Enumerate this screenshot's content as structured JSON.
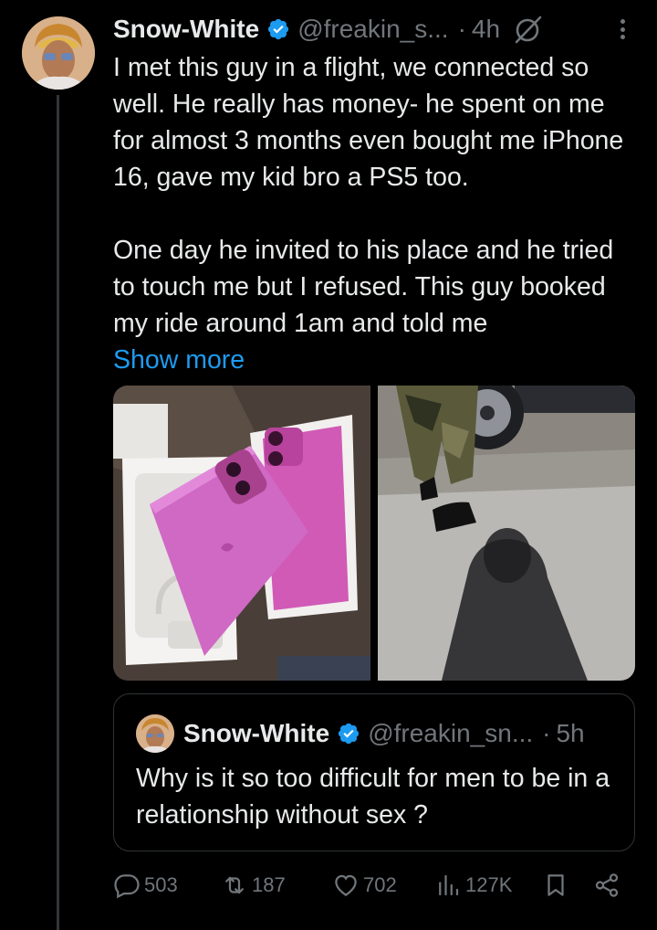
{
  "post": {
    "author_name": "Snow-White",
    "author_handle": "@freakin_s...",
    "dot": "·",
    "time": "4h",
    "paragraph1": "I met this guy in a flight, we connected so well. He really has money- he spent on me for almost 3 months even bought me iPhone 16, gave my kid bro a PS5 too.",
    "paragraph2": "One day he invited to his place and he tried to touch me but I refused. This guy booked my ride around 1am and told me",
    "show_more": "Show more"
  },
  "quote": {
    "author_name": "Snow-White",
    "author_handle": "@freakin_sn...",
    "dot": "·",
    "time": "5h",
    "text": "Why is it so too difficult for men to be in a relationship without sex ?"
  },
  "actions": {
    "replies": "503",
    "reposts": "187",
    "likes": "702",
    "views": "127K"
  },
  "colors": {
    "background": "#000000",
    "text": "#e7e9ea",
    "secondary": "#71767b",
    "link": "#1d9bf0",
    "border": "#2f3336",
    "verified": "#1d9bf0"
  }
}
